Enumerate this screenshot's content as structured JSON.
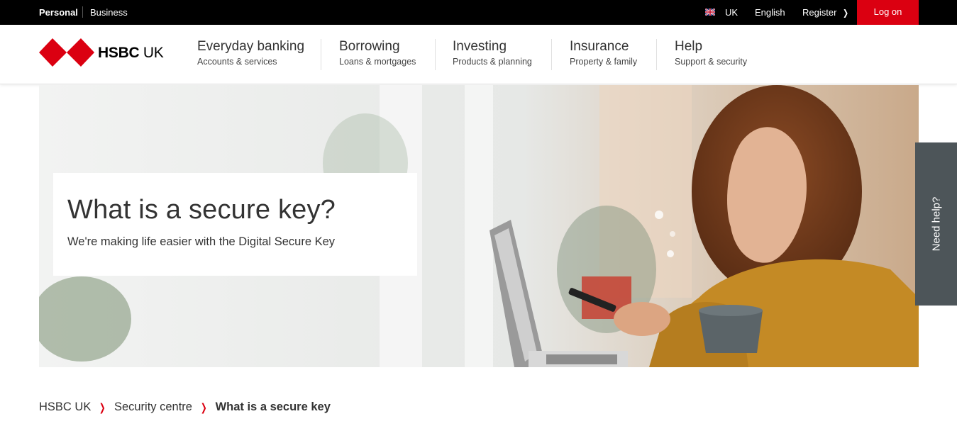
{
  "topbar": {
    "personal": "Personal",
    "business": "Business",
    "country": "UK",
    "language": "English",
    "register": "Register",
    "logon": "Log on"
  },
  "brand": {
    "name_bold": "HSBC",
    "name_light": "UK",
    "red": "#db0011"
  },
  "nav": [
    {
      "title": "Everyday banking",
      "sub": "Accounts & services"
    },
    {
      "title": "Borrowing",
      "sub": "Loans & mortgages"
    },
    {
      "title": "Investing",
      "sub": "Products & planning"
    },
    {
      "title": "Insurance",
      "sub": "Property & family"
    },
    {
      "title": "Help",
      "sub": "Support & security"
    }
  ],
  "hero": {
    "title": "What is a secure key?",
    "subtitle": "We're making life easier with the Digital Secure Key"
  },
  "need_help": "Need help?",
  "breadcrumb": {
    "home": "HSBC UK",
    "section": "Security centre",
    "current": "What is a secure key"
  },
  "icons": {
    "flag": "uk-flag-icon",
    "register_chevron": "chevron-right-icon",
    "breadcrumb_chevron": "chevron-right-icon"
  }
}
